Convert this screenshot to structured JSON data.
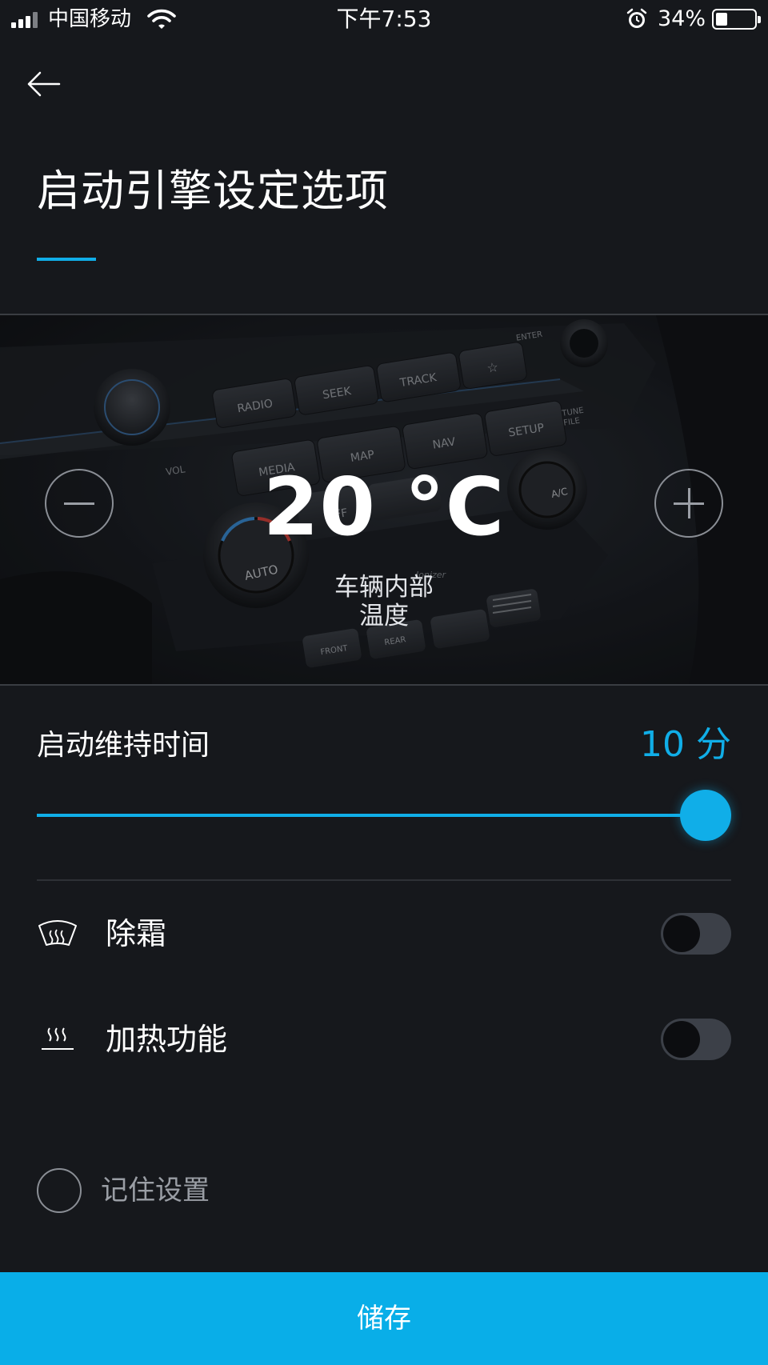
{
  "status_bar": {
    "carrier": "中国移动",
    "time": "下午7:53",
    "battery_percent": "34%",
    "battery_level": 0.34,
    "icons": [
      "signal-icon",
      "wifi-icon",
      "alarm-icon",
      "battery-icon"
    ]
  },
  "header": {
    "back_icon": "arrow-left-icon",
    "title": "启动引擎设定选项"
  },
  "climate": {
    "temperature": "20 °C",
    "label": "车辆内部\n温度",
    "label_line1": "车辆内部",
    "label_line2": "温度",
    "decrease_icon": "minus-icon",
    "increase_icon": "plus-icon",
    "dashboard_text": {
      "radio": "RADIO",
      "seek": "SEEK",
      "track": "TRACK",
      "enter": "ENTER",
      "media": "MEDIA",
      "map": "MAP",
      "nav": "NAV",
      "setup": "SETUP",
      "tune": "TUNE",
      "file": "FILE",
      "vol": "VOL",
      "off": "OFF",
      "auto": "AUTO",
      "ac": "A/C",
      "front": "FRONT",
      "rear": "REAR",
      "ionizer": "Ionizer"
    }
  },
  "duration": {
    "label": "启动维持时间",
    "value": "10 分",
    "slider_fraction": 1.0
  },
  "options": [
    {
      "label": "除霜",
      "icon": "defrost-icon",
      "enabled": false
    },
    {
      "label": "加热功能",
      "icon": "heating-icon",
      "enabled": false
    }
  ],
  "remember": {
    "label": "记住设置",
    "checked": false
  },
  "save_label": "储存",
  "colors": {
    "accent": "#10aee8",
    "background": "#16181c",
    "save_bg": "#09aee8"
  }
}
